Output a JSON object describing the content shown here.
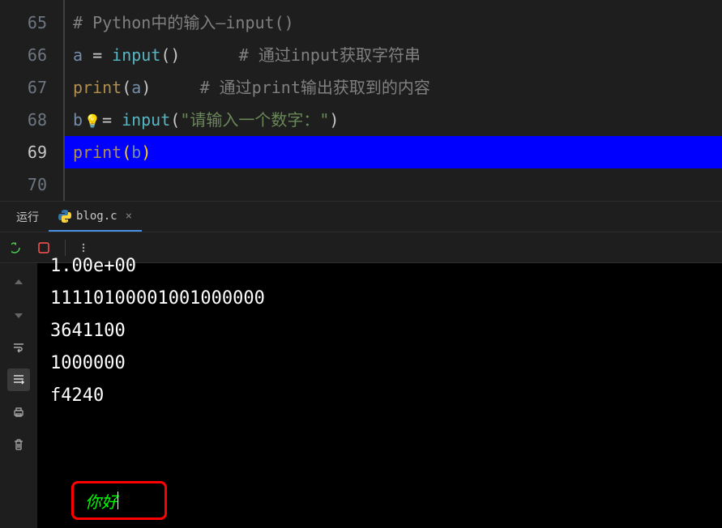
{
  "editor": {
    "lines": [
      {
        "num": "65",
        "active": false
      },
      {
        "num": "66",
        "active": false
      },
      {
        "num": "67",
        "active": false
      },
      {
        "num": "68",
        "active": false
      },
      {
        "num": "69",
        "active": true
      },
      {
        "num": "70",
        "active": false
      }
    ],
    "code": {
      "line65_comment": "# Python中的输入—input()",
      "line66_var": "a",
      "line66_op": " = ",
      "line66_fn": "input",
      "line66_comment": "# 通过input获取字符串",
      "line67_fn": "print",
      "line67_arg": "a",
      "line67_comment": "# 通过print输出获取到的内容",
      "line68_var": "b",
      "line68_op": " = ",
      "line68_fn": "input",
      "line68_str": "\"请输入一个数字：\"",
      "line69_fn": "print",
      "line69_arg": "b"
    }
  },
  "panel": {
    "run_label": "运行",
    "file_tab": "blog.c"
  },
  "terminal": {
    "output": [
      "1.00e+00",
      "11110100001001000000",
      "3641100",
      "1000000",
      "f4240",
      "",
      ""
    ],
    "input_value": "你好"
  }
}
